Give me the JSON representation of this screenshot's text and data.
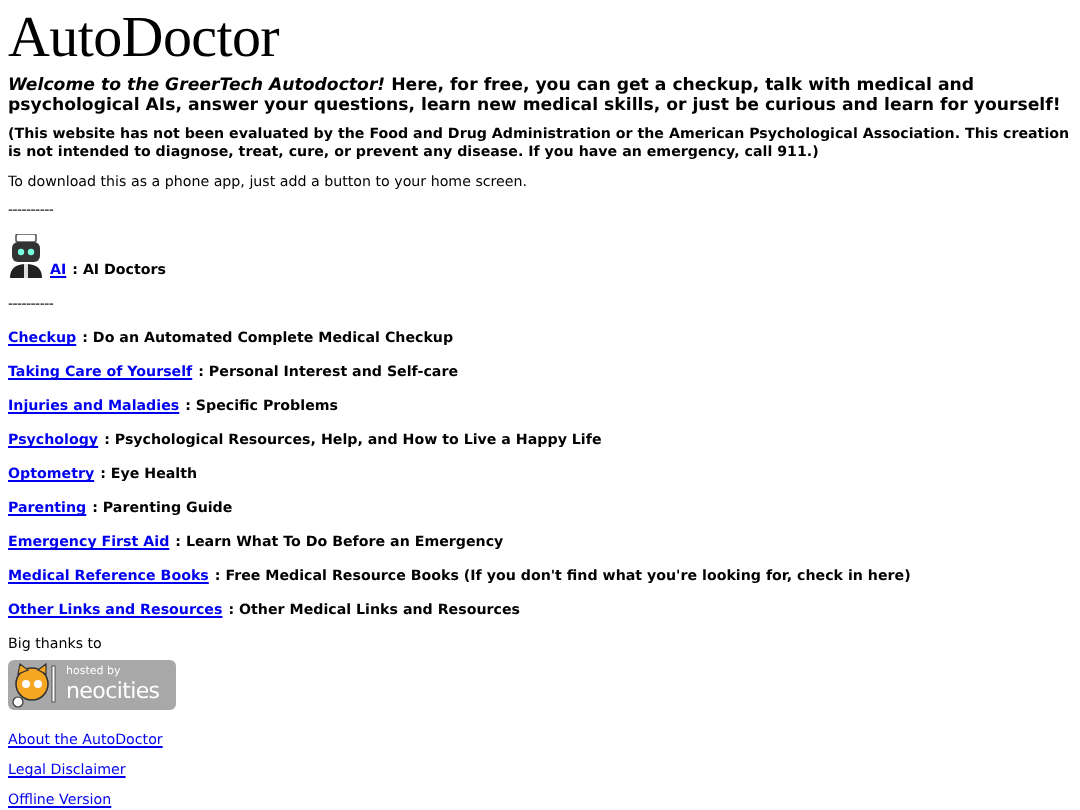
{
  "title": "AutoDoctor",
  "intro": "*Welcome to the GreerTech Autodoctor!* Here, for free, you can get a checkup, talk with medical and psychological AIs, answer your questions, learn new medical skills, or just be curious and learn for yourself!",
  "disclaimer": "(This website has not been evaluated by the Food and Drug Administration or the American Psychological Association. This creation is not intended to diagnose, treat, cure, or prevent any disease. If you have an emergency, call 911.)",
  "download_note": "To download this as a phone app, just add a button to your home screen.",
  "separators": [
    "----------",
    "----------"
  ],
  "ai_section": {
    "link": "AI",
    "description": ": AI Doctors"
  },
  "sections": [
    {
      "link": "Checkup",
      "description": ": Do an Automated Complete Medical Checkup"
    },
    {
      "link": "Taking Care of Yourself",
      "description": ": Personal Interest and Self-care"
    },
    {
      "link": "Injuries and Maladies",
      "description": ": Specific Problems"
    },
    {
      "link": "Psychology",
      "description": ": Psychological Resources, Help, and How to Live a Happy Life"
    },
    {
      "link": "Optometry",
      "description": ": Eye Health"
    },
    {
      "link": "Parenting",
      "description": ": Parenting Guide"
    },
    {
      "link": "Emergency First Aid",
      "description": ": Learn What To Do Before an Emergency"
    },
    {
      "link": "Medical Reference Books",
      "description": ": Free Medical Resource Books (If you don't find what you're looking for, check in here)"
    },
    {
      "link": "Other Links and Resources",
      "description": ": Other Medical Links and Resources"
    }
  ],
  "thanks": "Big thanks to",
  "badge": {
    "line_1": "hosted by",
    "line_2": "neocities"
  },
  "footer_links": [
    "About the AutoDoctor",
    "Legal Disclaimer",
    "Offline Version"
  ]
}
